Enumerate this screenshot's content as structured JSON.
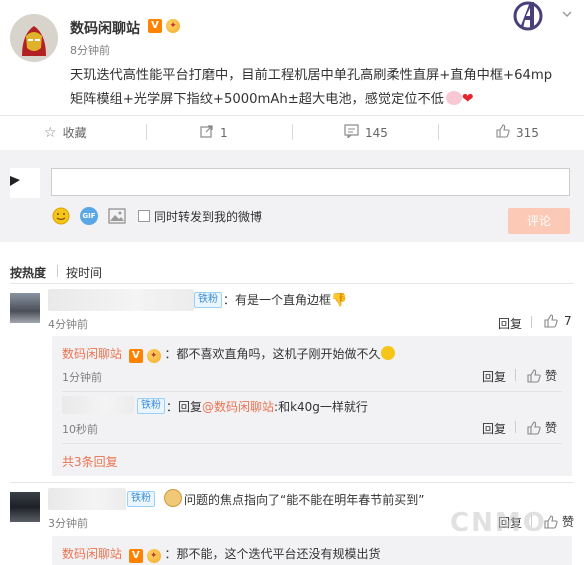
{
  "post": {
    "author": "数码闲聊站",
    "time": "8分钟前",
    "text_line1": "天玑迭代高性能平台打磨中，目前工程机居中单孔高刷柔性直屏+直角中框+64mp",
    "text_line2": "矩阵模组+光学屏下指纹+5000mAh±超大电池，感觉定位不低"
  },
  "actions": {
    "favorite": "收藏",
    "repost_count": "1",
    "comment_count": "145",
    "like_count": "315"
  },
  "composer": {
    "repost_label": "同时转发到我的微博",
    "submit": "评论"
  },
  "sort": {
    "hot": "按热度",
    "time": "按时间"
  },
  "comments": [
    {
      "badge": "铁粉",
      "text": "：有是一个直角边框",
      "time": "4分钟前",
      "reply": "回复",
      "likes": "7",
      "replies": [
        {
          "author": "数码闲聊站",
          "text": "：都不喜欢直角吗，这机子刚开始做不久",
          "time": "1分钟前",
          "reply": "回复",
          "like": "赞"
        },
        {
          "badge": "铁粉",
          "prefix": "：回复",
          "mention": "@数码闲聊站",
          "text": ":和k40g一样就行",
          "time": "10秒前",
          "reply": "回复",
          "like": "赞"
        }
      ],
      "more": "共3条回复"
    },
    {
      "badge": "铁粉",
      "text": "问题的焦点指向了“能不能在明年春节前买到”",
      "time": "3分钟前",
      "reply": "回复",
      "like": "赞",
      "replies": [
        {
          "author": "数码闲聊站",
          "text": "：那不能，这个迭代平台还没有规模出货"
        }
      ]
    }
  ],
  "watermark": "CNMO"
}
